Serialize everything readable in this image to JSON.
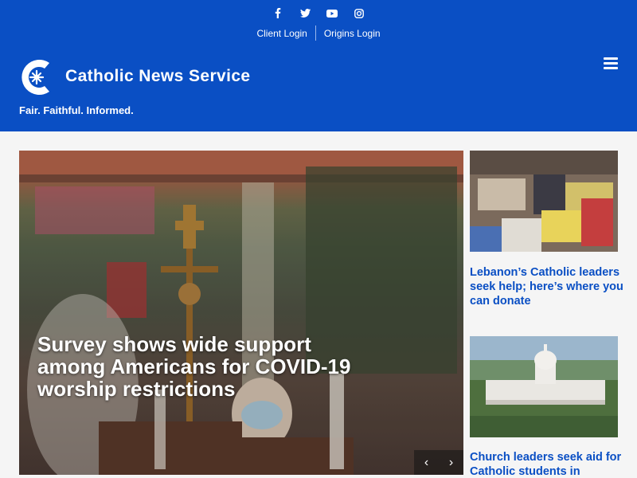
{
  "header": {
    "social": [
      {
        "name": "facebook",
        "glyph": "f"
      },
      {
        "name": "twitter",
        "glyph": ""
      },
      {
        "name": "youtube",
        "glyph": ""
      },
      {
        "name": "instagram",
        "glyph": ""
      }
    ],
    "client_login": "Client Login",
    "origins_login": "Origins Login",
    "brand": "Catholic News Service",
    "tagline": "Fair. Faithful. Informed.",
    "menu_icon": "hamburger-icon",
    "colors": {
      "bar": "#0a4fc4",
      "text": "#ffffff",
      "link": "#0a4fc4"
    }
  },
  "hero": {
    "title": "Survey shows wide support among Americans for COVID-19 worship restrictions",
    "prev_icon": "‹",
    "next_icon": "›"
  },
  "side": [
    {
      "title": "Lebanon’s Catholic leaders seek help; here’s where you can donate"
    },
    {
      "title": "Church leaders seek aid for Catholic students in"
    }
  ]
}
